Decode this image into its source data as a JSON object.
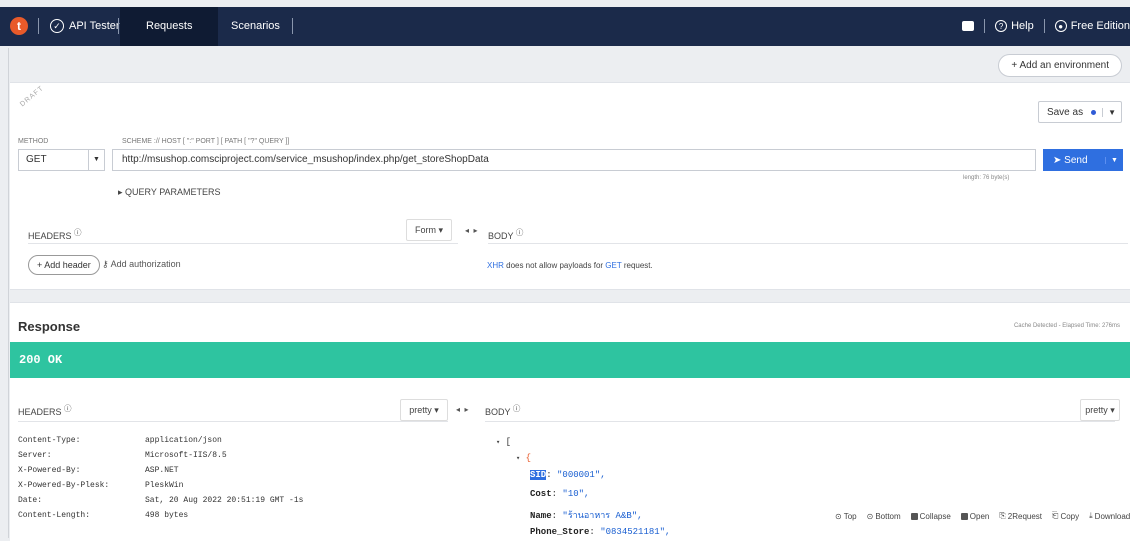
{
  "topbar": {
    "logo": "t",
    "app_name": "API Tester",
    "tabs": [
      "Requests",
      "Scenarios"
    ],
    "help": "Help",
    "edition": "Free Edition"
  },
  "env": {
    "add_env": "+ Add an environment"
  },
  "request": {
    "draft": "DRAFT",
    "save_as": "Save as",
    "method_label": "METHOD",
    "url_hint": "SCHEME :// HOST [ \":\" PORT ] [ PATH [ \"?\" QUERY ]]",
    "method": "GET",
    "url": "http://msushop.comsciproject.com/service_msushop/index.php/get_storeShopData",
    "send": "Send",
    "length": "length: 76 byte(s)",
    "query_params": "QUERY PARAMETERS",
    "headers": "HEADERS",
    "form": "Form",
    "body": "BODY",
    "add_header": "+ Add header",
    "add_auth": "Add authorization",
    "xhr_pre": "XHR",
    "xhr_mid": " does not allow payloads for ",
    "xhr_get": "GET",
    "xhr_post": " request."
  },
  "response": {
    "title": "Response",
    "elapsed": "Cache Detected - Elapsed Time: 276ms",
    "status": "200 OK",
    "headers": "HEADERS",
    "pretty": "pretty",
    "body": "BODY",
    "header_rows": [
      {
        "k": "Content-Type:",
        "v": "application/json"
      },
      {
        "k": "Server:",
        "v": "Microsoft-IIS/8.5"
      },
      {
        "k": "X-Powered-By:",
        "v": "ASP.NET"
      },
      {
        "k": "X-Powered-By-Plesk:",
        "v": "PleskWin"
      },
      {
        "k": "Date:",
        "v": "Sat, 20 Aug 2022 20:51:19 GMT -1s"
      },
      {
        "k": "Content-Length:",
        "v": "498 bytes"
      }
    ],
    "json": {
      "open_arr": "[",
      "open_obj": "{",
      "sid_key": "SID",
      "sid_val": "\"000001\",",
      "cost_key": "Cost",
      "cost_val": "\"10\",",
      "name_key": "Name",
      "name_val": "\"ร้านอาหาร A&B\",",
      "phone_key": "Phone_Store",
      "phone_val": "\"0834521181\","
    },
    "toolbar": [
      "Top",
      "Bottom",
      "Collapse",
      "Open",
      "2Request",
      "Copy",
      "Download"
    ]
  }
}
